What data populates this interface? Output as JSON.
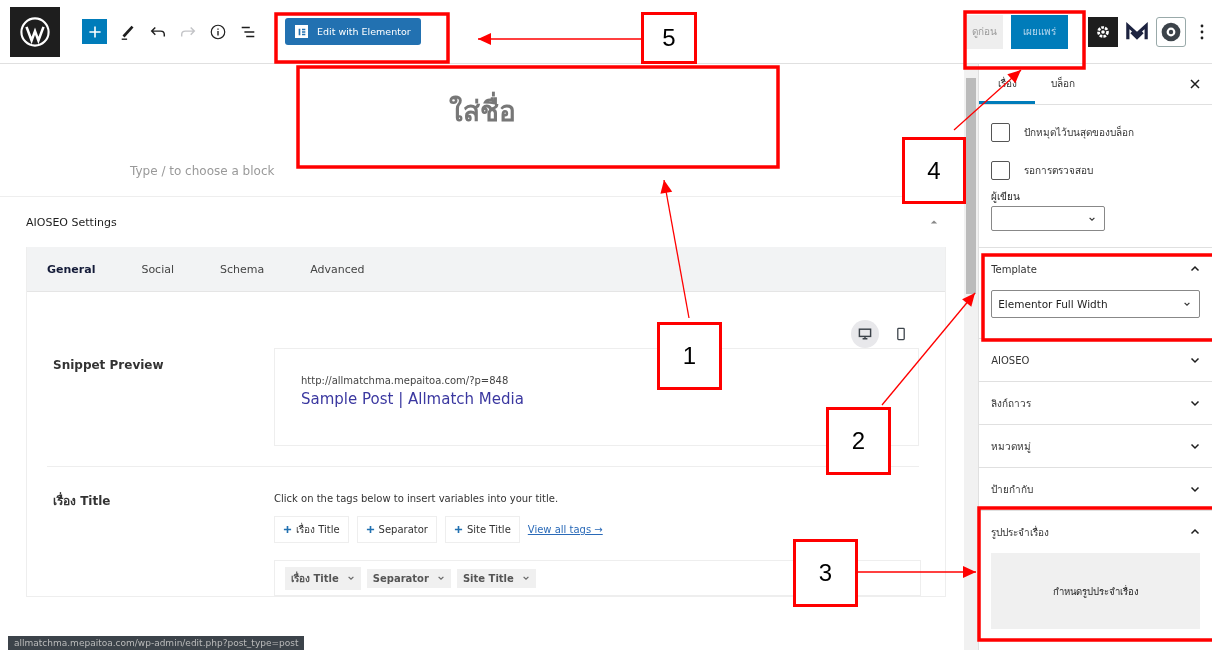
{
  "toolbar": [
    {
      "kind": "add",
      "disabled": false
    },
    {
      "kind": "tools",
      "disabled": false
    },
    {
      "kind": "undo",
      "disabled": false
    },
    {
      "kind": "redo",
      "disabled": true
    },
    {
      "kind": "details",
      "disabled": false
    },
    {
      "kind": "list-view",
      "disabled": false
    }
  ],
  "elementor_button": "Edit with Elementor",
  "preview_button": "ดูก่อน",
  "publish_button": "เผยแพร่",
  "title_field": {
    "placeholder": "ใส่ชื่อ"
  },
  "block_prompt": "Type / to choose a block",
  "aioseo": {
    "title": "AIOSEO Settings",
    "expanded": true,
    "tabs": [
      {
        "label": "General",
        "selected": true
      },
      {
        "label": "Social",
        "selected": false
      },
      {
        "label": "Schema",
        "selected": false
      },
      {
        "label": "Advanced",
        "selected": false
      }
    ],
    "devices": [
      {
        "kind": "desktop",
        "selected": true
      },
      {
        "kind": "mobile",
        "selected": false
      }
    ],
    "snippet": {
      "label": "Snippet Preview",
      "url": "http://allmatchma.mepaitoa.com/?p=848",
      "title": "Sample Post | Allmatch Media"
    },
    "title_setting": {
      "label": "เรื่อง Title",
      "hint": "Click on the tags below to insert variables into your title.",
      "tags": [
        "เรื่อง Title",
        "Separator",
        "Site Title"
      ],
      "view_all": "View all tags →",
      "tokens": [
        "เรื่อง Title",
        "Separator",
        "Site Title"
      ]
    }
  },
  "sidebar": {
    "tabs": [
      {
        "label": "เรื่อง",
        "selected": true
      },
      {
        "label": "บล็อก",
        "selected": false
      }
    ],
    "checkboxes": [
      {
        "label": "ปักหมุดไว้บนสุดของบล็อก",
        "checked": false
      },
      {
        "label": "รอการตรวจสอบ",
        "checked": false
      }
    ],
    "author": {
      "label": "ผู้เขียน"
    },
    "panels": [
      {
        "title": "Template",
        "expanded": true,
        "select": "Elementor Full Width"
      },
      {
        "title": "AIOSEO",
        "expanded": false
      },
      {
        "title": "ลิงก์ถาวร",
        "expanded": false
      },
      {
        "title": "หมวดหมู่",
        "expanded": false
      },
      {
        "title": "ป้ายกำกับ",
        "expanded": false
      },
      {
        "title": "รูปประจำเรื่อง",
        "expanded": true,
        "button": "กำหนดรูปประจำเรื่อง"
      }
    ]
  },
  "status_url": "allmatchma.mepaitoa.com/wp-admin/edit.php?post_type=post",
  "annotations": [
    {
      "label": "5"
    },
    {
      "label": "1"
    },
    {
      "label": "2"
    },
    {
      "label": "3"
    },
    {
      "label": "4"
    }
  ]
}
